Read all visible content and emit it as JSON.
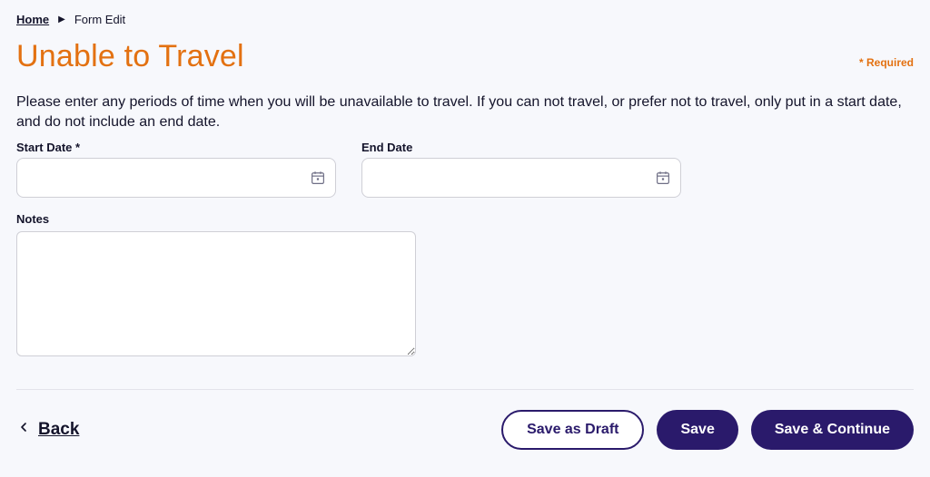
{
  "breadcrumb": {
    "home": "Home",
    "current": "Form Edit"
  },
  "header": {
    "title": "Unable to Travel",
    "required_note": "* Required"
  },
  "instructions": "Please enter any periods of time when you will be unavailable to travel. If you can not travel, or prefer not to travel, only put in a start date, and do not include an end date.",
  "fields": {
    "start_date": {
      "label": "Start Date *",
      "value": ""
    },
    "end_date": {
      "label": "End Date",
      "value": ""
    },
    "notes": {
      "label": "Notes",
      "value": ""
    }
  },
  "footer": {
    "back": "Back",
    "save_draft": "Save as Draft",
    "save": "Save",
    "save_continue": "Save & Continue"
  }
}
